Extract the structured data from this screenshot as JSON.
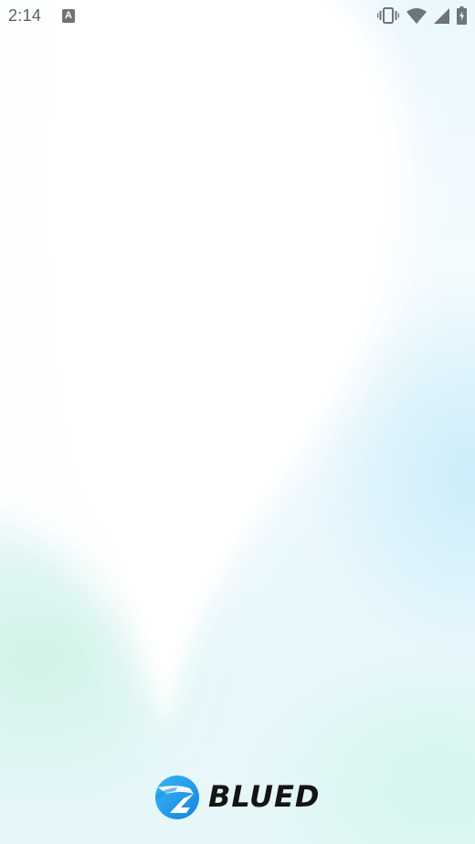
{
  "status_bar": {
    "time": "2:14",
    "notification_glyph": "A",
    "icons": [
      "vibrate-icon",
      "wifi-icon",
      "cell-signal-icon",
      "battery-icon"
    ]
  },
  "splash": {
    "brand_name": "BLUED",
    "logo_icon": "blued-logo-icon",
    "colors": {
      "brand_blue": "#1e9ef0",
      "wordmark": "#141414",
      "background_tint": "#eaf7fd"
    }
  }
}
